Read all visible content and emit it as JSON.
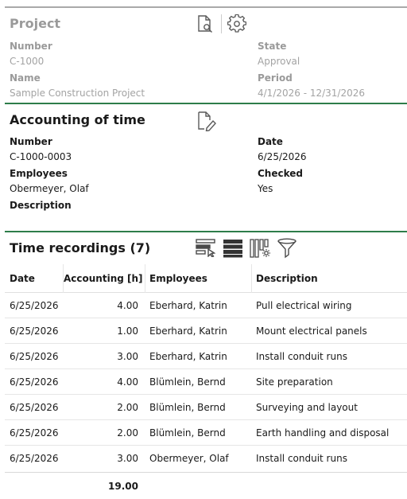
{
  "project": {
    "title": "Project",
    "number_label": "Number",
    "number_value": "C-1000",
    "state_label": "State",
    "state_value": "Approval",
    "name_label": "Name",
    "name_value": "Sample Construction Project",
    "period_label": "Period",
    "period_value": "4/1/2026 - 12/31/2026",
    "icons": [
      "document-search-icon",
      "gear-icon"
    ]
  },
  "accounting": {
    "title": "Accounting of time",
    "number_label": "Number",
    "number_value": "C-1000-0003",
    "date_label": "Date",
    "date_value": "6/25/2026",
    "employees_label": "Employees",
    "employees_value": "Obermeyer, Olaf",
    "checked_label": "Checked",
    "checked_value": "Yes",
    "description_label": "Description",
    "icons": [
      "edit-document-icon"
    ]
  },
  "time_recordings": {
    "title": "Time recordings (7)",
    "icons": [
      "select-row-icon",
      "list-view-icon",
      "column-settings-icon",
      "filter-icon"
    ],
    "columns": {
      "date": "Date",
      "accounting": "Accounting [h]",
      "employees": "Employees",
      "description": "Description"
    },
    "rows": [
      {
        "date": "6/25/2026",
        "hours": "4.00",
        "employee": "Eberhard, Katrin",
        "description": "Pull electrical wiring"
      },
      {
        "date": "6/25/2026",
        "hours": "1.00",
        "employee": "Eberhard, Katrin",
        "description": "Mount electrical panels"
      },
      {
        "date": "6/25/2026",
        "hours": "3.00",
        "employee": "Eberhard, Katrin",
        "description": "Install conduit runs"
      },
      {
        "date": "6/25/2026",
        "hours": "4.00",
        "employee": "Blümlein, Bernd",
        "description": "Site preparation"
      },
      {
        "date": "6/25/2026",
        "hours": "2.00",
        "employee": "Blümlein, Bernd",
        "description": "Surveying and layout"
      },
      {
        "date": "6/25/2026",
        "hours": "2.00",
        "employee": "Blümlein, Bernd",
        "description": "Earth handling and disposal"
      },
      {
        "date": "6/25/2026",
        "hours": "3.00",
        "employee": "Obermeyer, Olaf",
        "description": "Install conduit runs"
      }
    ],
    "total_hours": "19.00"
  },
  "colors": {
    "section_rule": "#2e7d4a",
    "top_rule": "#a9a9a9",
    "muted_text": "#9a9a9a"
  }
}
